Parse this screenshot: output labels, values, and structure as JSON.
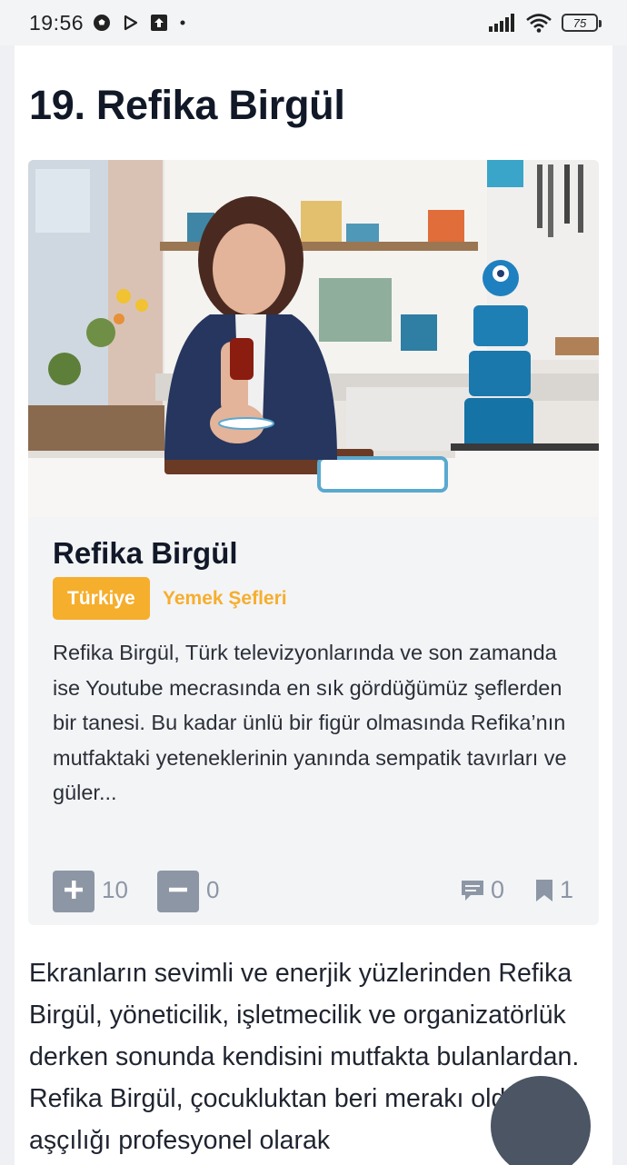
{
  "status_bar": {
    "time": "19:56",
    "battery": "75"
  },
  "article": {
    "heading": "19. Refika Birgül",
    "card": {
      "title": "Refika Birgül",
      "country_tag": "Türkiye",
      "category": "Yemek Şefleri",
      "excerpt": "Refika Birgül, Türk televizyonlarında ve son zamanda ise Youtube mecrasında en sık gördüğümüz şeflerden bir tanesi. Bu kadar ünlü bir figür olmasında Refika’nın mutfaktaki yeteneklerinin yanında sempatik tavırları ve güler...",
      "upvotes": "10",
      "downvotes": "0",
      "comments": "0",
      "bookmarks": "1"
    },
    "body_text": "Ekranların sevimli ve enerjik yüzlerinden Refika Birgül, yöneticilik, işletmecilik ve organizatörlük derken sonunda kendisini mutfakta bulanlardan. Refika Birgül, çocukluktan beri merakı olduğu aşçılığı profesyonel olarak"
  },
  "colors": {
    "accent": "#f6ae2d",
    "muted": "#8d96a5",
    "card_bg": "#f3f4f6"
  },
  "icons": [
    "football-icon",
    "play-store-icon",
    "upload-icon",
    "signal-icon",
    "wifi-icon",
    "battery-icon",
    "plus-icon",
    "minus-icon",
    "comment-icon",
    "bookmark-icon"
  ]
}
